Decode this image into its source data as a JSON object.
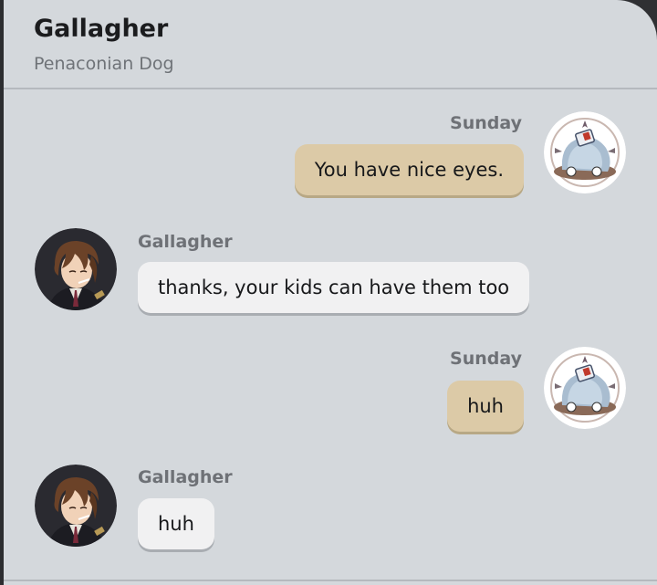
{
  "header": {
    "title": "Gallagher",
    "subtitle": "Penaconian Dog"
  },
  "messages": [
    {
      "sender": "Sunday",
      "text": "You have nice eyes.",
      "side": "right"
    },
    {
      "sender": "Gallagher",
      "text": "thanks, your kids can have them too",
      "side": "left"
    },
    {
      "sender": "Sunday",
      "text": "huh",
      "side": "right"
    },
    {
      "sender": "Gallagher",
      "text": "huh",
      "side": "left"
    }
  ],
  "colors": {
    "background": "#d4d8dc",
    "outgoing_bubble": "#dccaa7",
    "incoming_bubble": "#f1f1f2"
  },
  "icons": {
    "sunday_avatar": "sunday-avatar",
    "gallagher_avatar": "gallagher-avatar"
  }
}
